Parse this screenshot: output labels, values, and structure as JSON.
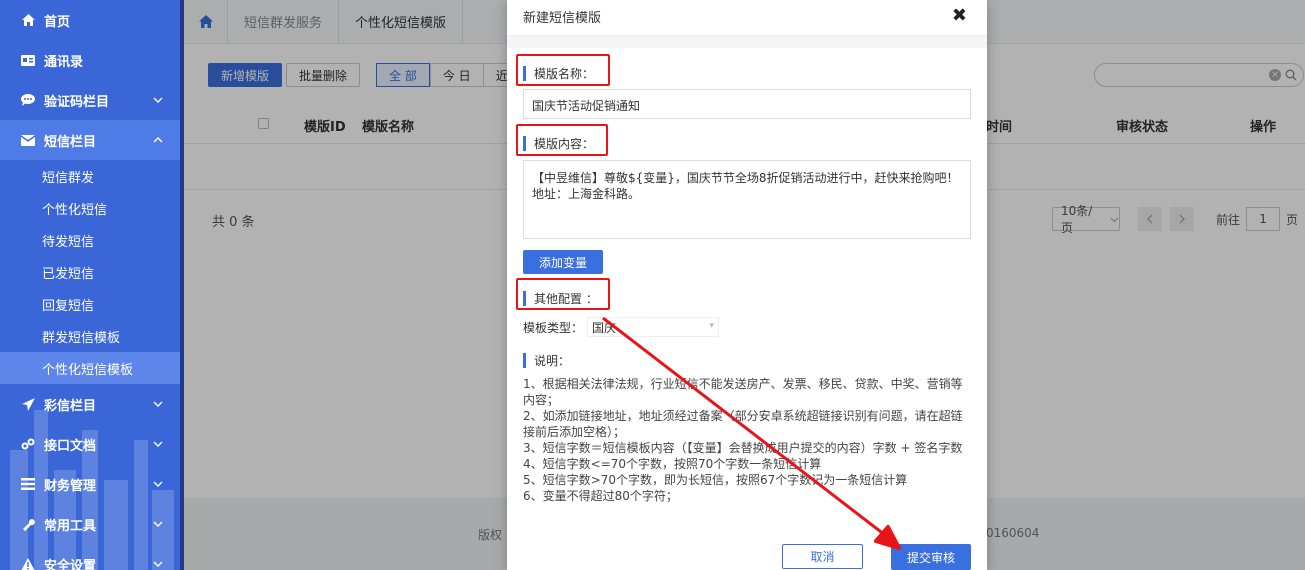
{
  "sidebar": {
    "items": [
      {
        "label": "首页",
        "icon": "home-icon"
      },
      {
        "label": "通讯录",
        "icon": "contacts-icon"
      },
      {
        "label": "验证码栏目",
        "icon": "chat-icon"
      },
      {
        "label": "短信栏目",
        "icon": "mail-icon"
      },
      {
        "label": "彩信栏目",
        "icon": "paper-plane-icon"
      },
      {
        "label": "接口文档",
        "icon": "link-icon"
      },
      {
        "label": "财务管理",
        "icon": "bars-icon"
      },
      {
        "label": "常用工具",
        "icon": "wrench-icon"
      },
      {
        "label": "安全设置",
        "icon": "warning-icon"
      }
    ],
    "sms_subitems": [
      "短信群发",
      "个性化短信",
      "待发短信",
      "已发短信",
      "回复短信",
      "群发短信模板",
      "个性化短信模板"
    ]
  },
  "breadcrumb": {
    "items": [
      "短信群发服务",
      "个性化短信模版"
    ]
  },
  "toolbar": {
    "add_label": "新增模版",
    "batch_delete_label": "批量删除",
    "filters": [
      "全 部",
      "今 日",
      "近7日"
    ]
  },
  "table": {
    "headers": {
      "id": "模版ID",
      "name": "模版名称",
      "time": "时间",
      "status": "审核状态",
      "action": "操作"
    }
  },
  "pagination": {
    "total": "共 0 条",
    "page_size": "10条/页",
    "goto_label": "前往",
    "goto_value": "1",
    "page_label": "页"
  },
  "footer": {
    "left": "版权",
    "right": "0160604"
  },
  "modal": {
    "title": "新建短信模版",
    "name_label": "模版名称：",
    "name_value": "国庆节活动促销通知",
    "content_label": "模版内容：",
    "content_value": "【中昱维信】尊敬${变量}，国庆节节全场8折促销活动进行中，赶快来抢购吧！地址：上海金科路。",
    "add_variable_label": "添加变量",
    "other_config_label": "其他配置 ：",
    "type_label": "模板类型：",
    "type_value": "国庆",
    "notes_label": "说明：",
    "notes": [
      "1、根据相关法律法规，行业短信不能发送房产、发票、移民、贷款、中奖、营销等内容；",
      "2、如添加链接地址，地址须经过备案（部分安卓系统超链接识别有问题，请在超链接前后添加空格）；",
      "3、短信字数＝短信模板内容（【变量】会替换成用户提交的内容）字数 + 签名字数",
      "4、短信字数<=70个字数，按照70个字数一条短信计算",
      "5、短信字数>70个字数，即为长短信，按照67个字数记为一条短信计算",
      "6、变量不得超过80个字符；"
    ],
    "cancel_label": "取消",
    "submit_label": "提交审核"
  },
  "colors": {
    "primary": "#3a6fdf",
    "sidebar": "#3a66d8",
    "highlight": "#e8141a"
  }
}
